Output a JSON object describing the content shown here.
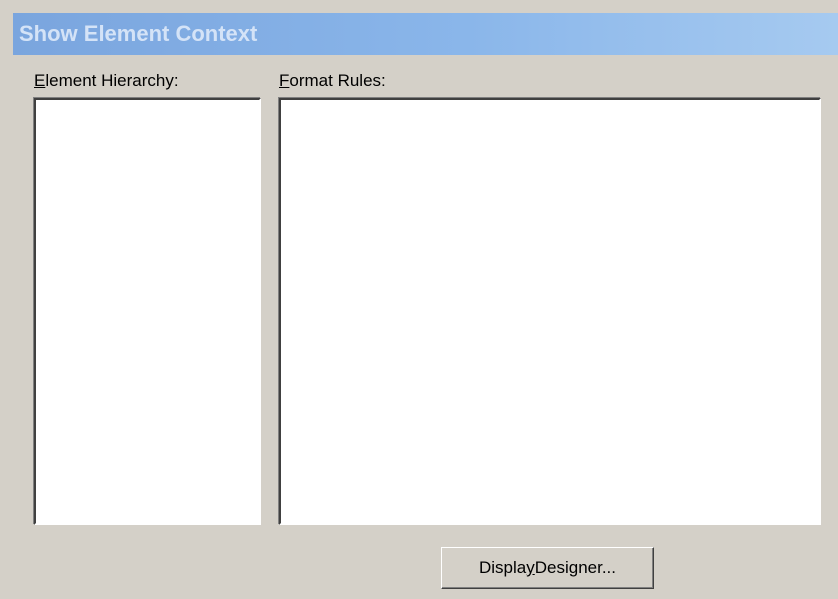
{
  "window": {
    "title": "Show Element Context"
  },
  "hierarchy": {
    "label_accel": "E",
    "label_rest": "lement Hierarchy:"
  },
  "format_rules": {
    "label_accel": "F",
    "label_rest": "ormat Rules:"
  },
  "display_designer_button": {
    "label_before": "Displa",
    "label_accel": "y",
    "label_after": " Designer..."
  },
  "colors": {
    "titlebar_start": "#7aa5de",
    "titlebar_end": "#a6caf0",
    "title_text": "#d4e3f7",
    "face": "#d4d0c8"
  }
}
